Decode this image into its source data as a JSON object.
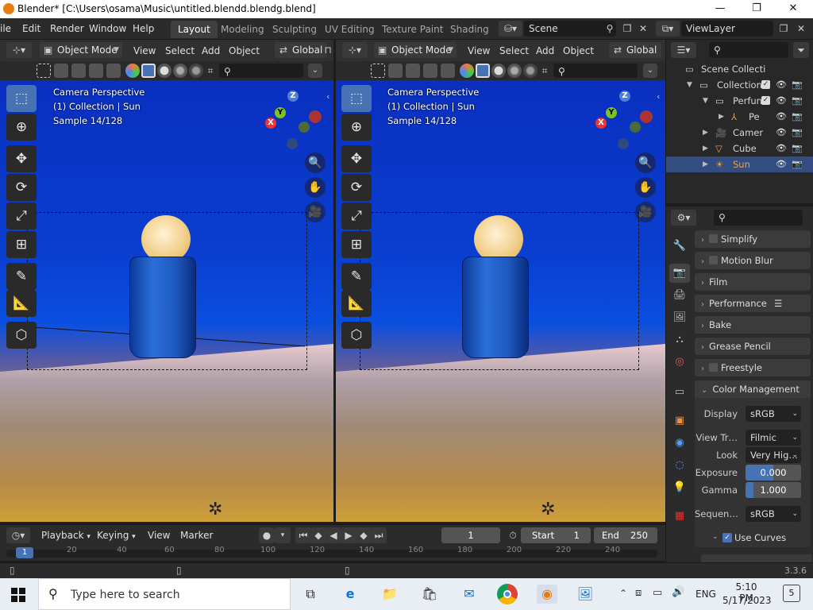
{
  "window": {
    "title": "Blender* [C:\\Users\\osama\\Music\\untitled.blendd.blendg.blend]",
    "minimize": "—",
    "maximize": "❐",
    "close": "✕"
  },
  "menubar": {
    "items": [
      "ile",
      "Edit",
      "Render",
      "Window",
      "Help"
    ],
    "workspaces": [
      "Layout",
      "Modeling",
      "Sculpting",
      "UV Editing",
      "Texture Paint",
      "Shading"
    ],
    "active_workspace": "Layout",
    "scene": "Scene",
    "view_layer": "ViewLayer"
  },
  "viewport_left": {
    "mode": "Object Mode",
    "menus": [
      "View",
      "Select",
      "Add",
      "Object"
    ],
    "transform": "Global",
    "overlay_lines": [
      "Camera Perspective",
      "(1) Collection | Sun",
      "Sample 14/128"
    ]
  },
  "viewport_right": {
    "mode": "Object Mode",
    "menus": [
      "View",
      "Select",
      "Add",
      "Object"
    ],
    "transform": "Global",
    "overlay_lines": [
      "Camera Perspective",
      "(1) Collection | Sun",
      "Sample 14/128"
    ]
  },
  "gizmo": {
    "z": "Z",
    "y": "Y",
    "x": "X"
  },
  "timeline": {
    "menus": [
      "Playback",
      "Keying",
      "View",
      "Marker"
    ],
    "current_frame": "1",
    "start_label": "Start",
    "start": "1",
    "end_label": "End",
    "end": "250",
    "ticks": [
      "1",
      "20",
      "40",
      "60",
      "80",
      "100",
      "120",
      "140",
      "160",
      "180",
      "200",
      "220",
      "240"
    ]
  },
  "outliner": {
    "rows": [
      {
        "label": "Scene Collecti",
        "icon": "scene-collection-icon"
      },
      {
        "label": "Collection",
        "icon": "collection-icon"
      },
      {
        "label": "Perfun",
        "icon": "collection-icon"
      },
      {
        "label": "Pe",
        "icon": "armature-icon"
      },
      {
        "label": "Camer",
        "icon": "camera-icon"
      },
      {
        "label": "Cube",
        "icon": "mesh-icon"
      },
      {
        "label": "Sun",
        "icon": "light-icon"
      }
    ]
  },
  "properties": {
    "panels": [
      "Simplify",
      "Motion Blur",
      "Film",
      "Performance",
      "Bake",
      "Grease Pencil",
      "Freestyle",
      "Color Management"
    ],
    "display_label": "Display",
    "display_value": "sRGB",
    "view_transform_label": "View Tr…",
    "view_transform_value": "Filmic",
    "look_label": "Look",
    "look_value": "Very Hig…",
    "exposure_label": "Exposure",
    "exposure_value": "0.000",
    "gamma_label": "Gamma",
    "gamma_value": "1.000",
    "sequencer_label": "Sequen…",
    "sequencer_value": "sRGB",
    "use_curves_label": "Use Curves"
  },
  "statusbar": {
    "version": "3.3.6"
  },
  "taskbar": {
    "search_placeholder": "Type here to search",
    "language": "ENG",
    "time": "5:10 PM",
    "date": "5/17/2023",
    "notifications": "5"
  },
  "colors": {
    "accent": "#4772b3",
    "selection": "#334d80",
    "sky": "#0a3fd0"
  }
}
